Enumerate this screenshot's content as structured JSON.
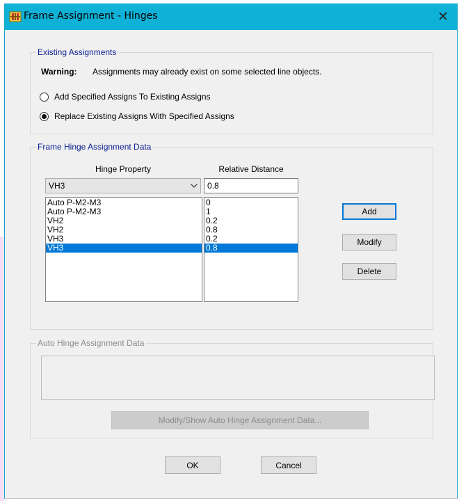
{
  "window": {
    "title": "Frame Assignment - Hinges",
    "close_glyph": "✕"
  },
  "existing": {
    "title": "Existing Assignments",
    "warning_label": "Warning:",
    "warning_text": "Assignments may already exist on some selected line objects.",
    "options": [
      {
        "label": "Add Specified Assigns To Existing Assigns",
        "checked": false
      },
      {
        "label": "Replace Existing Assigns With Specified Assigns",
        "checked": true
      }
    ]
  },
  "hinge_data": {
    "title": "Frame Hinge Assignment Data",
    "col_property": "Hinge Property",
    "col_distance": "Relative Distance",
    "property_value": "VH3",
    "distance_value": "0.8",
    "rows": [
      {
        "property": "Auto  P-M2-M3",
        "distance": "0"
      },
      {
        "property": "Auto  P-M2-M3",
        "distance": "1"
      },
      {
        "property": "VH2",
        "distance": "0.2"
      },
      {
        "property": "VH2",
        "distance": "0.8"
      },
      {
        "property": "VH3",
        "distance": "0.2"
      },
      {
        "property": "VH3",
        "distance": "0.8"
      }
    ],
    "selected_row": 5,
    "add_label": "Add",
    "modify_label": "Modify",
    "delete_label": "Delete"
  },
  "auto_hinge": {
    "title": "Auto Hinge Assignment Data",
    "button_label": "Modify/Show Auto Hinge Assignment Data..."
  },
  "footer": {
    "ok_label": "OK",
    "cancel_label": "Cancel"
  },
  "colors": {
    "titlebar": "#0fb1d6",
    "selection": "#0078d7",
    "group_title": "#0a1f8f"
  }
}
